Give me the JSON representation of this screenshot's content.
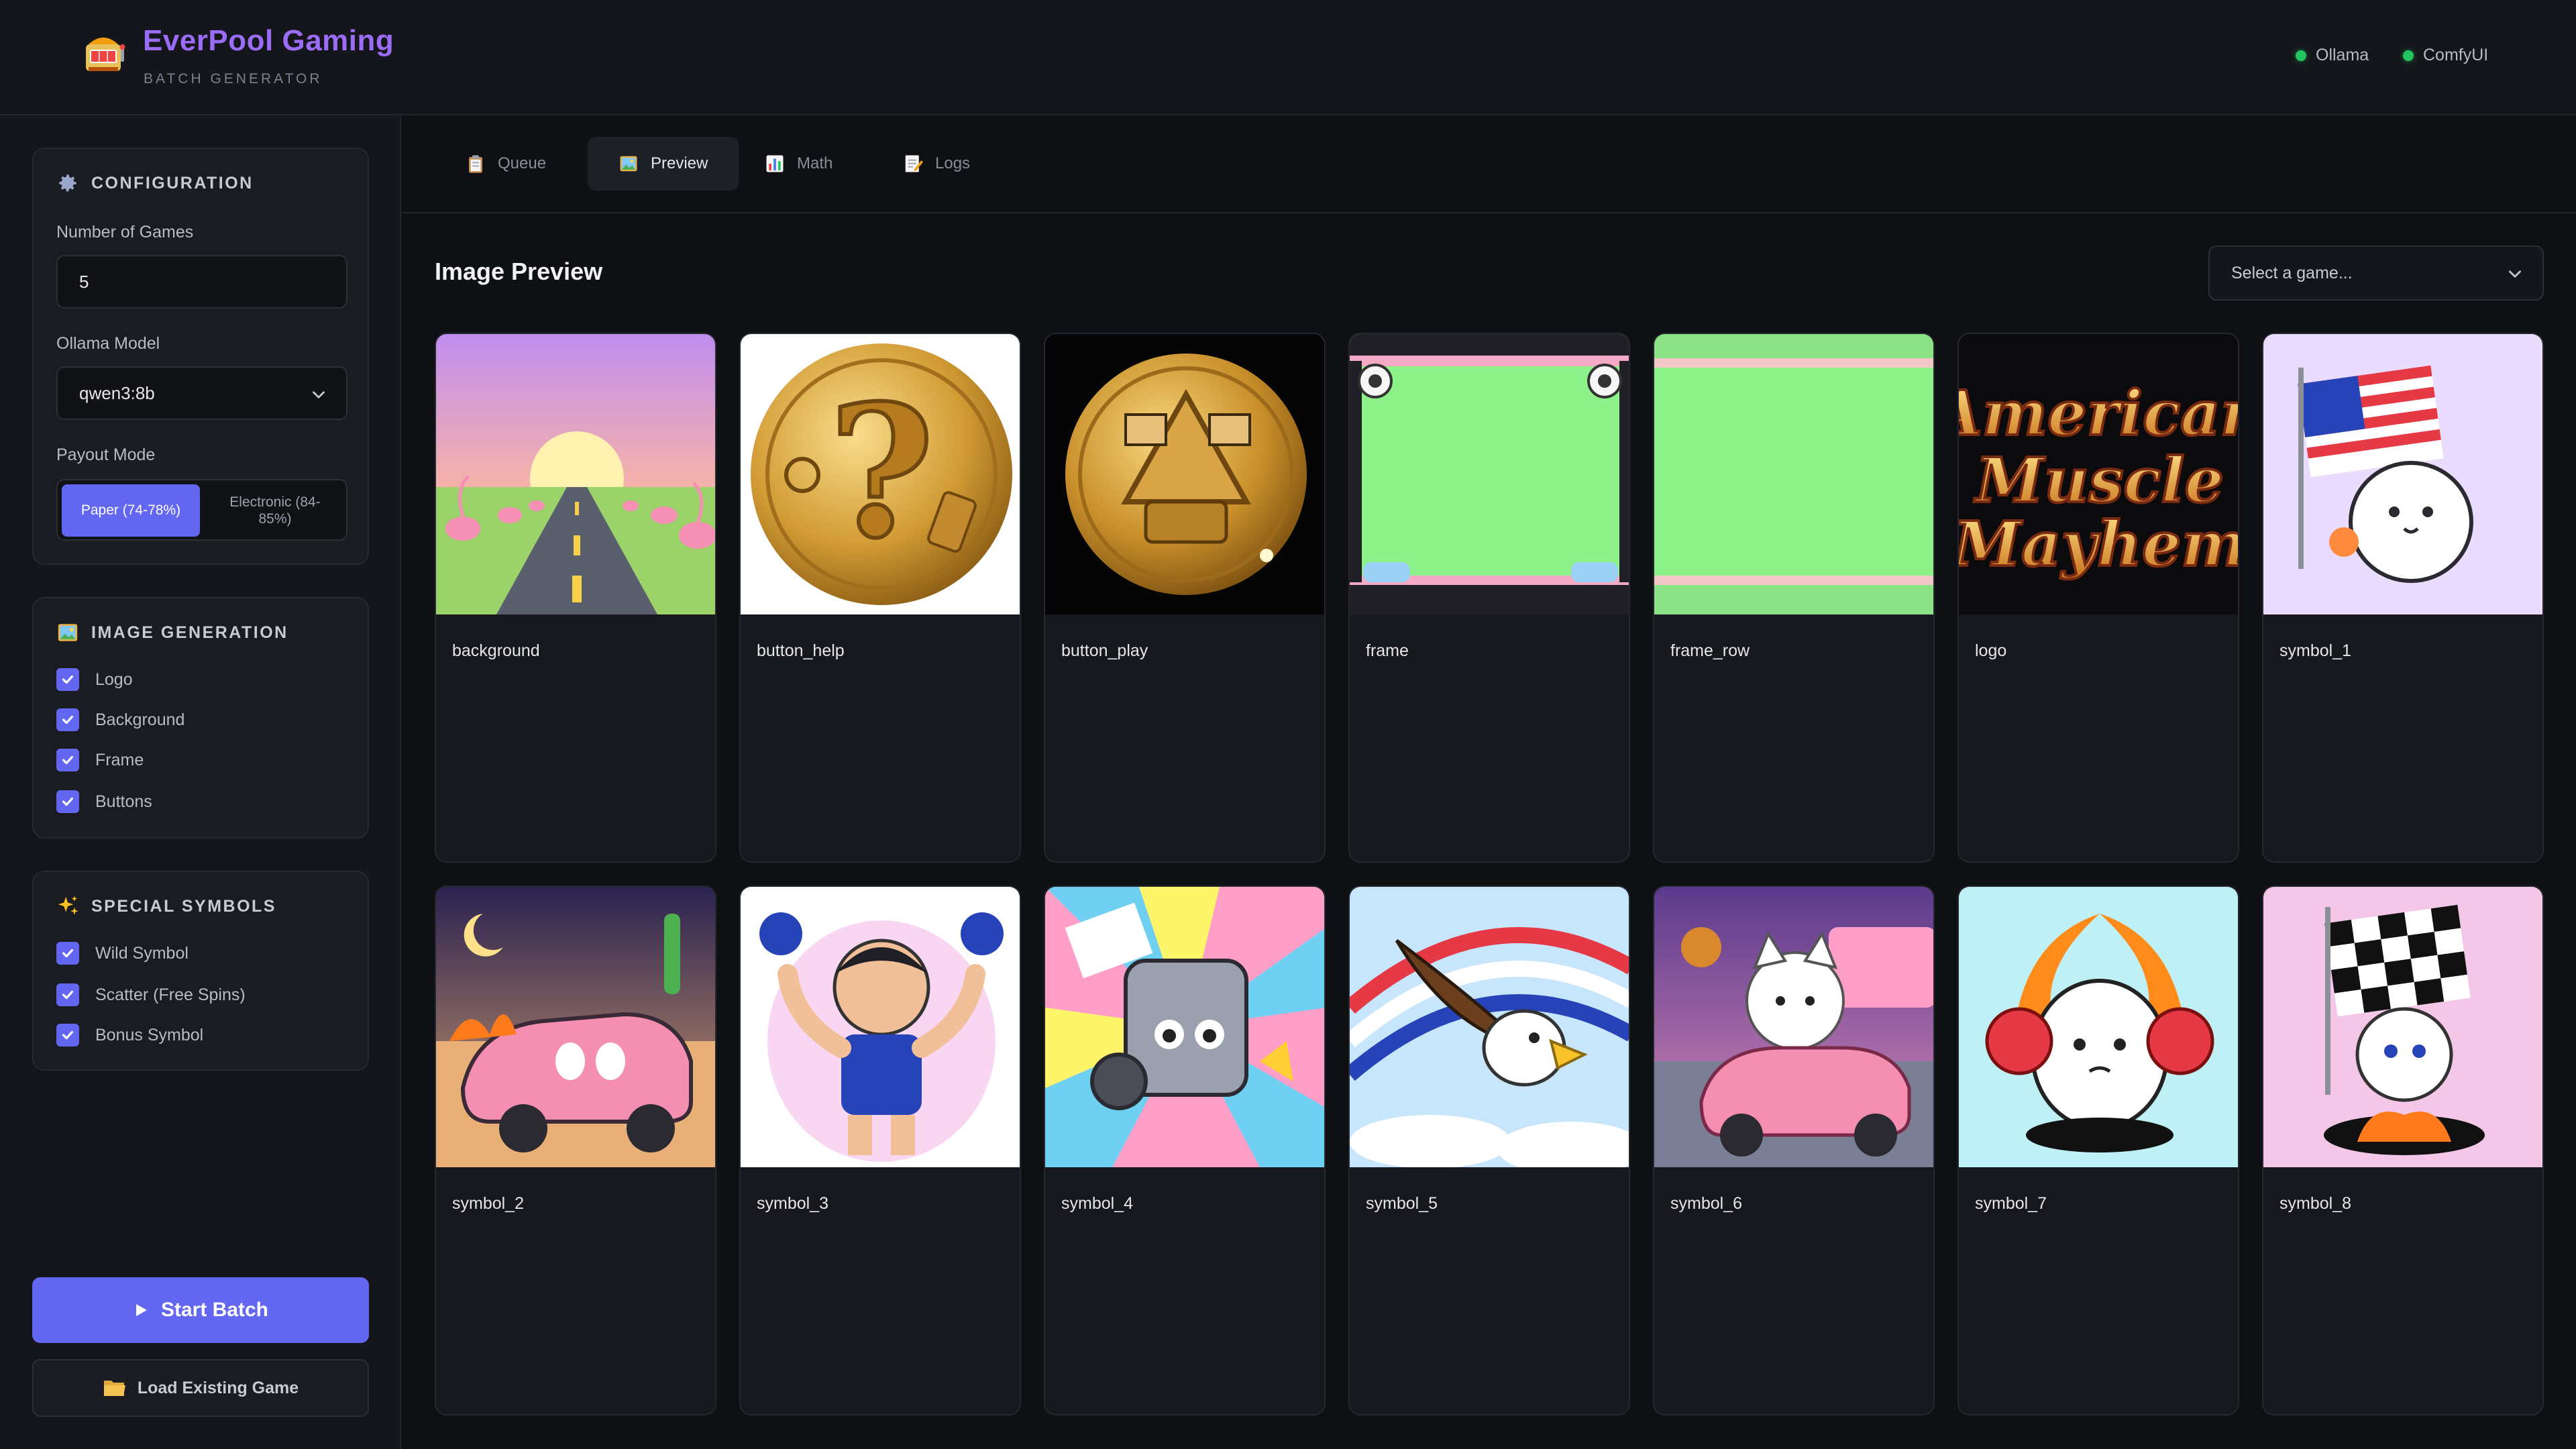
{
  "header": {
    "brand_title": "EverPool Gaming",
    "brand_subtitle": "BATCH GENERATOR",
    "logo_icon": "slot-machine-icon",
    "status": [
      {
        "label": "Ollama",
        "state_color": "#22c55e"
      },
      {
        "label": "ComfyUI",
        "state_color": "#22c55e"
      }
    ]
  },
  "sidebar": {
    "configuration": {
      "title": "CONFIGURATION",
      "icon": "gear-icon",
      "num_games_label": "Number of Games",
      "num_games_value": "5",
      "model_label": "Ollama Model",
      "model_value": "qwen3:8b",
      "payout_label": "Payout Mode",
      "payout_options": [
        "Paper (74-78%)",
        "Electronic (84-85%)"
      ],
      "payout_selected": "Paper (74-78%)"
    },
    "image_generation": {
      "title": "IMAGE GENERATION",
      "icon": "picture-icon",
      "items": [
        {
          "label": "Logo",
          "checked": true
        },
        {
          "label": "Background",
          "checked": true
        },
        {
          "label": "Frame",
          "checked": true
        },
        {
          "label": "Buttons",
          "checked": true
        }
      ]
    },
    "special_symbols": {
      "title": "SPECIAL SYMBOLS",
      "icon": "sparkles-icon",
      "items": [
        {
          "label": "Wild Symbol",
          "checked": true
        },
        {
          "label": "Scatter (Free Spins)",
          "checked": true
        },
        {
          "label": "Bonus Symbol",
          "checked": true
        }
      ]
    },
    "start_button": "Start Batch",
    "load_button": "Load Existing Game"
  },
  "tabs": [
    {
      "label": "Queue",
      "icon": "clipboard-icon",
      "active": false
    },
    {
      "label": "Preview",
      "icon": "picture-icon",
      "active": true
    },
    {
      "label": "Math",
      "icon": "bar-chart-icon",
      "active": false
    },
    {
      "label": "Logs",
      "icon": "memo-icon",
      "active": false
    }
  ],
  "preview": {
    "title": "Image Preview",
    "game_select_placeholder": "Select a game...",
    "images": [
      {
        "name": "background"
      },
      {
        "name": "button_help"
      },
      {
        "name": "button_play"
      },
      {
        "name": "frame"
      },
      {
        "name": "frame_row"
      },
      {
        "name": "logo"
      },
      {
        "name": "symbol_1"
      },
      {
        "name": "symbol_2"
      },
      {
        "name": "symbol_3"
      },
      {
        "name": "symbol_4"
      },
      {
        "name": "symbol_5"
      },
      {
        "name": "symbol_6"
      },
      {
        "name": "symbol_7"
      },
      {
        "name": "symbol_8"
      }
    ],
    "logo_art_text": [
      "American",
      "Muscle",
      "Mayhem"
    ]
  },
  "colors": {
    "accent": "#6366f1",
    "brand": "#9b6cf5",
    "status_ok": "#22c55e",
    "bg": "#0f1014",
    "panel": "#15161b"
  }
}
